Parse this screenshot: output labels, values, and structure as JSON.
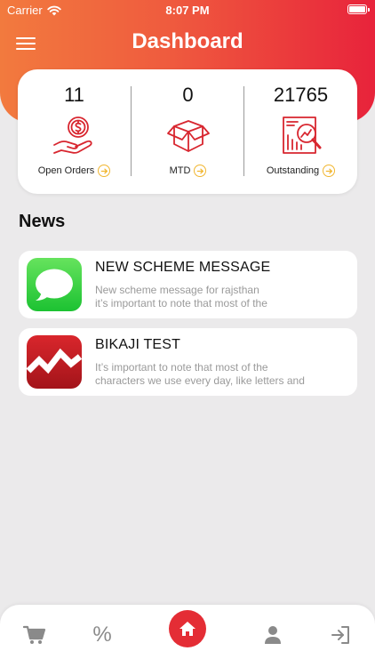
{
  "status_bar": {
    "carrier": "Carrier",
    "time": "8:07 PM"
  },
  "header": {
    "title": "Dashboard",
    "menu_icon": "hamburger-menu-icon"
  },
  "stats": [
    {
      "value": "11",
      "label": "Open Orders",
      "icon": "money-hand-icon"
    },
    {
      "value": "0",
      "label": "MTD",
      "icon": "open-box-icon"
    },
    {
      "value": "21765",
      "label": "Outstanding",
      "icon": "chart-magnifier-icon"
    }
  ],
  "colors": {
    "accent": "#e42d35",
    "gradient_start": "#f27a3e",
    "gradient_end": "#e8233b",
    "icon_red": "#d8262f",
    "arrow_yellow": "#f1b630"
  },
  "news": {
    "heading": "News",
    "items": [
      {
        "title": "NEW SCHEME MESSAGE",
        "description": "New scheme message for rajsthan\nit’s important to note that most of the",
        "icon": "messages-app-icon"
      },
      {
        "title": "BIKAJI TEST",
        "description": "It’s important to note that most of the\ncharacters we use every day, like letters and",
        "icon": "bikaji-logo-icon"
      }
    ]
  },
  "bottom_nav": [
    "cart-icon",
    "percent-icon",
    "home-icon",
    "user-icon",
    "logout-icon"
  ],
  "bottom_nav_percent": "%"
}
